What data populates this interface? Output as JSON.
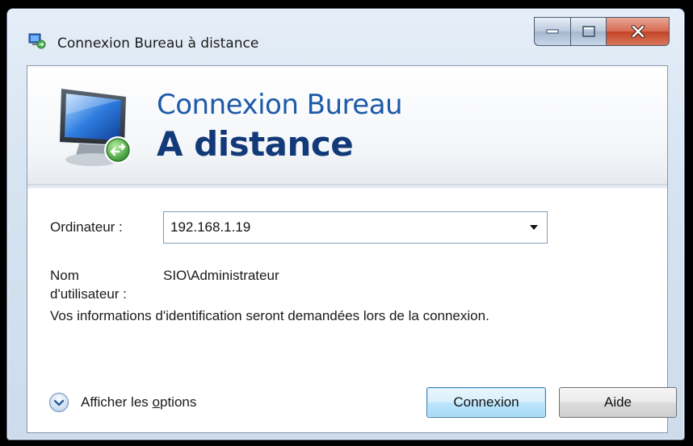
{
  "window": {
    "title": "Connexion Bureau à distance"
  },
  "banner": {
    "line1": "Connexion Bureau",
    "line2": "A distance"
  },
  "form": {
    "computer_label": "Ordinateur :",
    "computer_value": "192.168.1.19",
    "username_label_line1": "Nom",
    "username_label_line2": "d'utilisateur :",
    "username_value": "SIO\\Administrateur",
    "info_message": "Vos informations d'identification seront demandées lors de la connexion."
  },
  "options": {
    "label_prefix": "Afficher les ",
    "label_underlined": "o",
    "label_suffix": "ptions"
  },
  "buttons": {
    "connect": "Connexion",
    "help": "Aide"
  },
  "colors": {
    "banner_line1": "#1e5aa8",
    "banner_line2": "#123a78",
    "close_button": "#c24226",
    "primary_button_border": "#3c7fb1"
  },
  "icons": {
    "app": "remote-desktop-icon",
    "banner": "remote-desktop-monitor-icon",
    "options": "expand-chevron-circle-icon",
    "combo": "dropdown-arrow-icon"
  }
}
